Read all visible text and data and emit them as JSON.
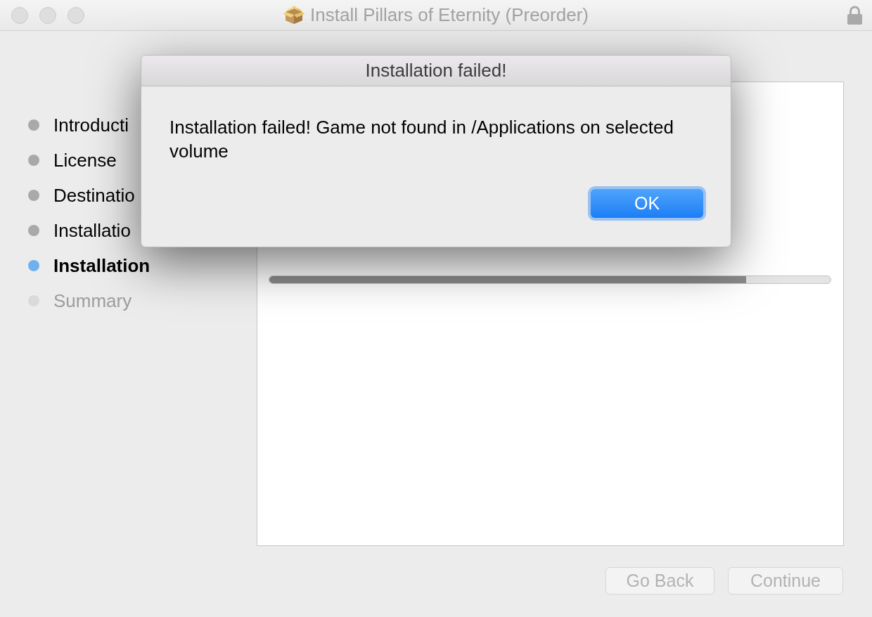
{
  "window": {
    "title": "Install Pillars of Eternity (Preorder)"
  },
  "sidebar": {
    "items": [
      {
        "label": "Introducti",
        "selected": false,
        "disabled": false
      },
      {
        "label": "License",
        "selected": false,
        "disabled": false
      },
      {
        "label": "Destinatio",
        "selected": false,
        "disabled": false
      },
      {
        "label": "Installatio",
        "selected": false,
        "disabled": false
      },
      {
        "label": "Installation",
        "selected": true,
        "disabled": false
      },
      {
        "label": "Summary",
        "selected": false,
        "disabled": true
      }
    ]
  },
  "content": {
    "progress": {
      "level": 0.85
    }
  },
  "buttons": [
    {
      "label": "Go Back",
      "disabled": true
    },
    {
      "label": "Continue",
      "disabled": true
    }
  ],
  "dialog": {
    "title": "Installation failed!",
    "message": "Installation failed! Game not found in /Applications on selected volume",
    "buttons": [
      {
        "label": "OK",
        "default": true
      }
    ]
  }
}
